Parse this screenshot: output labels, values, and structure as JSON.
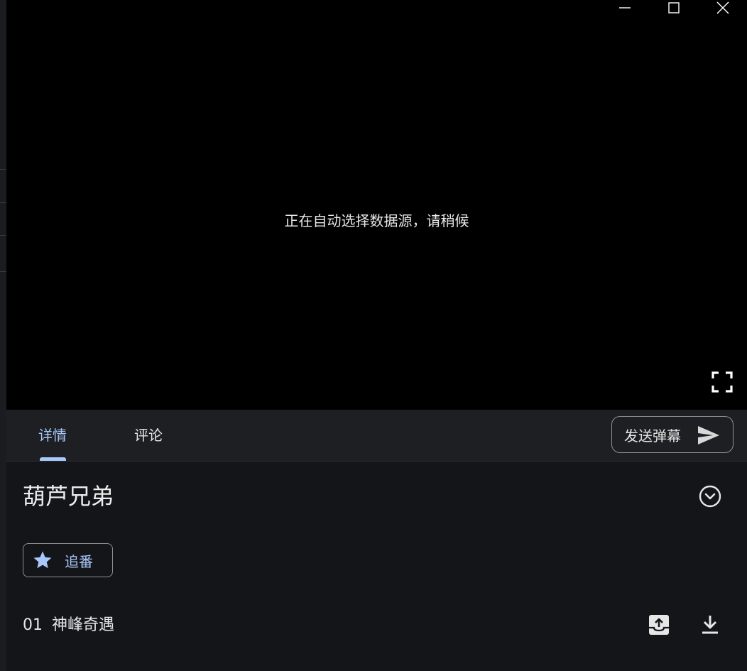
{
  "window": {
    "minimize_icon": "minimize-icon",
    "maximize_icon": "maximize-icon",
    "close_icon": "close-icon"
  },
  "player": {
    "status_text": "正在自动选择数据源，请稍候",
    "fullscreen_icon": "fullscreen-icon"
  },
  "tabs": [
    {
      "label": "详情",
      "active": true
    },
    {
      "label": "评论",
      "active": false
    }
  ],
  "danmaku": {
    "label": "发送弹幕",
    "icon": "send-icon"
  },
  "detail": {
    "title": "葫芦兄弟",
    "expand_icon": "chevron-down-circle-icon",
    "follow_label": "追番",
    "follow_icon": "star-icon"
  },
  "episodes": [
    {
      "number": "01",
      "title": "神峰奇遇"
    }
  ],
  "colors": {
    "accent": "#a8c7fa",
    "panel_bg": "#141519",
    "tabbar_bg": "#1e1f23",
    "video_bg": "#000000"
  }
}
